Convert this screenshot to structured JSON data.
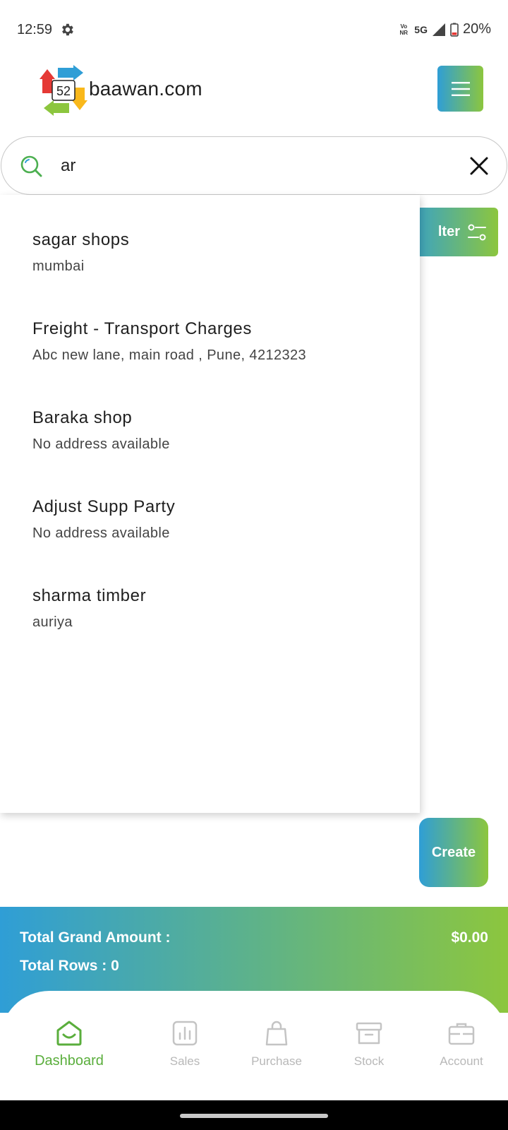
{
  "status_bar": {
    "time": "12:59",
    "network_top": "Vo",
    "network_bottom": "NR",
    "network_type": "5G",
    "battery": "20%"
  },
  "header": {
    "logo_number": "52",
    "logo_text": "baawan.com"
  },
  "search": {
    "value": "ar"
  },
  "filter_button": {
    "label": "lter"
  },
  "results": [
    {
      "name": "sagar shops",
      "address": "mumbai"
    },
    {
      "name": "Freight - Transport Charges",
      "address": "Abc new lane, main road , Pune, 4212323"
    },
    {
      "name": "Baraka shop",
      "address": "No address available"
    },
    {
      "name": "Adjust Supp Party",
      "address": "No address available"
    },
    {
      "name": "sharma timber",
      "address": "auriya"
    }
  ],
  "create_button": {
    "label": "Create"
  },
  "totals": {
    "grand_amount_label": "Total Grand Amount :",
    "grand_amount_value": "$0.00",
    "rows_label": "Total Rows : 0"
  },
  "bottom_nav": {
    "items": [
      {
        "label": "Dashboard",
        "icon": "dashboard-icon",
        "active": true
      },
      {
        "label": "Sales",
        "icon": "sales-chart-icon",
        "active": false
      },
      {
        "label": "Purchase",
        "icon": "shopping-bag-icon",
        "active": false
      },
      {
        "label": "Stock",
        "icon": "archive-box-icon",
        "active": false
      },
      {
        "label": "Account",
        "icon": "briefcase-icon",
        "active": false
      }
    ]
  },
  "colors": {
    "gradient_start": "#2f9ed6",
    "gradient_end": "#8cc63e",
    "active_nav": "#5aae3c",
    "inactive_nav": "#b8b8b8"
  }
}
